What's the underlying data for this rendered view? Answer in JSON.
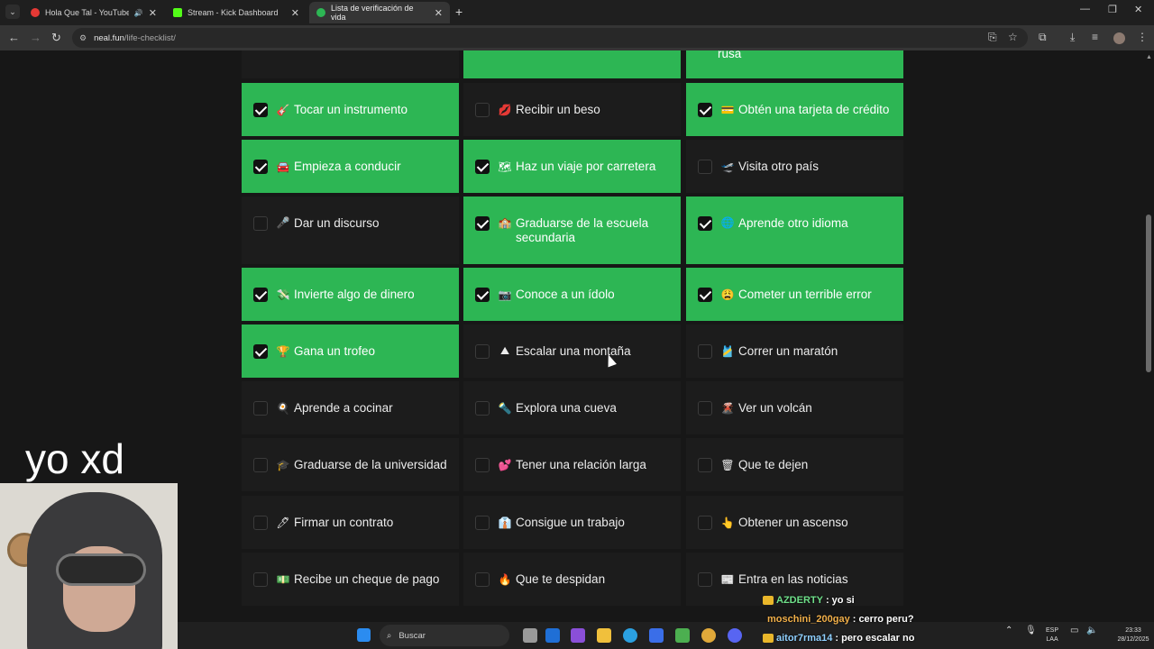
{
  "browser": {
    "tabs": [
      {
        "title": "Hola Que Tal - YouTube Mu",
        "icon": "youtube-icon",
        "color": "#e53935"
      },
      {
        "title": "Stream - Kick Dashboard",
        "icon": "kick-icon",
        "color": "#53fc18"
      },
      {
        "title": "Lista de verificación de vida",
        "icon": "check-circle-icon",
        "color": "#2db654"
      }
    ],
    "url_domain": "neal.fun",
    "url_path": "/life-checklist/"
  },
  "checklist": {
    "top_partial": {
      "col3_label": "rusa"
    },
    "rows": [
      [
        {
          "label": "Tocar un instrumento",
          "emoji": "🎸",
          "done": true
        },
        {
          "label": "Recibir un beso",
          "emoji": "💋",
          "done": false
        },
        {
          "label": "Obtén una tarjeta de crédito",
          "emoji": "💳",
          "done": true
        }
      ],
      [
        {
          "label": "Empieza a conducir",
          "emoji": "🚘",
          "done": true
        },
        {
          "label": "Haz un viaje por carretera",
          "emoji": "🗺",
          "done": true
        },
        {
          "label": "Visita otro país",
          "emoji": "🛫",
          "done": false
        }
      ],
      [
        {
          "label": "Dar un discurso",
          "emoji": "🎤",
          "done": false
        },
        {
          "label": "Graduarse de la escuela secundaria",
          "emoji": "🏫",
          "done": true
        },
        {
          "label": "Aprende otro idioma",
          "emoji": "🌐",
          "done": true
        }
      ],
      [
        {
          "label": "Invierte algo de dinero",
          "emoji": "💸",
          "done": true
        },
        {
          "label": "Conoce a un ídolo",
          "emoji": "📷",
          "done": true
        },
        {
          "label": "Cometer un terrible error",
          "emoji": "😩",
          "done": true
        }
      ],
      [
        {
          "label": "Gana un trofeo",
          "emoji": "🏆",
          "done": true
        },
        {
          "label": "Escalar una montaña",
          "emoji": "⛰",
          "done": false
        },
        {
          "label": "Correr un maratón",
          "emoji": "🎽",
          "done": false
        }
      ],
      [
        {
          "label": "Aprende a cocinar",
          "emoji": "🍳",
          "done": false
        },
        {
          "label": "Explora una cueva",
          "emoji": "🔦",
          "done": false
        },
        {
          "label": "Ver un volcán",
          "emoji": "🌋",
          "done": false
        }
      ],
      [
        {
          "label": "Graduarse de la universidad",
          "emoji": "🎓",
          "done": false
        },
        {
          "label": "Tener una relación larga",
          "emoji": "💕",
          "done": false
        },
        {
          "label": "Que te dejen",
          "emoji": "🗑",
          "done": false
        }
      ],
      [
        {
          "label": "Firmar un contrato",
          "emoji": "🖊",
          "done": false
        },
        {
          "label": "Consigue un trabajo",
          "emoji": "👔",
          "done": false
        },
        {
          "label": "Obtener un ascenso",
          "emoji": "👆",
          "done": false
        }
      ],
      [
        {
          "label": "Recibe un cheque de pago",
          "emoji": "💵",
          "done": false
        },
        {
          "label": "Que te despidan",
          "emoji": "🔥",
          "done": false
        },
        {
          "label": "Entra en las noticias",
          "emoji": "📰",
          "done": false
        }
      ]
    ]
  },
  "overlay": {
    "caption": "yo xd",
    "chat": [
      {
        "user": "AZDERTY",
        "user_color": "#6fe08a",
        "message": " : yo si"
      },
      {
        "user": "moschini_200gay",
        "user_color": "#f2b04a",
        "message": " : cerro peru?"
      },
      {
        "user": "aitor7rma14",
        "user_color": "#8fd0ff",
        "message": " : pero escalar no"
      }
    ]
  },
  "taskbar": {
    "search_placeholder": "Buscar",
    "lang_top": "ESP",
    "lang_bottom": "LAA",
    "time": "23:33",
    "date": "28/12/2025"
  },
  "colors": {
    "done": "#2db654",
    "card": "#1c1c1c",
    "page": "#171717"
  }
}
